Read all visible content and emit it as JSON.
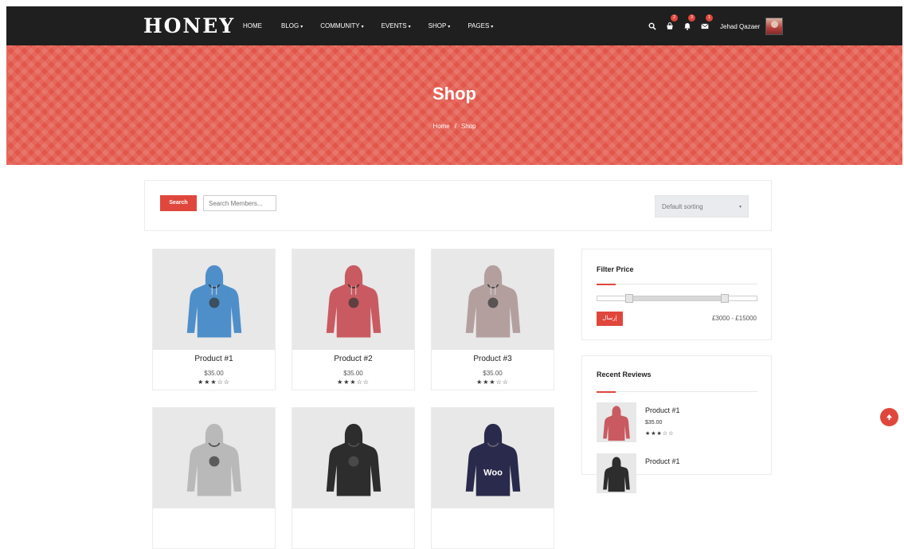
{
  "header": {
    "logo": "HONEY",
    "nav": [
      {
        "label": "HOME",
        "caret": ""
      },
      {
        "label": "BLOG",
        "caret": "▾"
      },
      {
        "label": "COMMUNITY",
        "caret": "▾"
      },
      {
        "label": "EVENTS",
        "caret": "▾"
      },
      {
        "label": "SHOP",
        "caret": "▾"
      },
      {
        "label": "PAGES",
        "caret": "▾"
      }
    ],
    "icons": [
      {
        "name": "search-icon",
        "badge": ""
      },
      {
        "name": "cart-icon",
        "badge": "2"
      },
      {
        "name": "bell-icon",
        "badge": "3"
      },
      {
        "name": "envelope-icon",
        "badge": "1"
      }
    ],
    "user_name": "Jehad Qazaer"
  },
  "hero": {
    "title": "Shop",
    "breadcrumb_home": "Home",
    "breadcrumb_sep": "/",
    "breadcrumb_current": "Shop",
    "color": "#e2564a"
  },
  "search": {
    "button_label": "Search",
    "placeholder": "Search Members...",
    "sort_value": "Default sorting",
    "sort_arrow": "▾"
  },
  "products": [
    {
      "name": "Product #1",
      "price": "$35.00",
      "stars": "★★★☆☆",
      "color": "#4f8fc9"
    },
    {
      "name": "Product #2",
      "price": "$35.00",
      "stars": "★★★☆☆",
      "color": "#c95a62"
    },
    {
      "name": "Product #3",
      "price": "$35.00",
      "stars": "★★★☆☆",
      "color": "#b49f9f"
    },
    {
      "name": "",
      "price": "",
      "stars": "",
      "color": "#b9b9b9"
    },
    {
      "name": "",
      "price": "",
      "stars": "",
      "color": "#2d2d2d"
    },
    {
      "name": "",
      "price": "",
      "stars": "",
      "color": "#2a2a4c",
      "print": "Woo"
    }
  ],
  "filter_widget": {
    "title": "Filter Price",
    "button_label": "إرسال",
    "price_range": "£3000 - £15000",
    "slider_min": 0.2,
    "slider_max": 0.8
  },
  "reviews_widget": {
    "title": "Recent Reviews",
    "items": [
      {
        "name": "Product #1",
        "price": "$35.00",
        "stars": "★★★☆☆",
        "color": "#c95a62"
      },
      {
        "name": "Product #1",
        "price": "",
        "stars": "",
        "color": "#2d2d2d"
      }
    ]
  },
  "colors": {
    "accent": "#e0473c",
    "navbar": "#1f1f1f"
  }
}
